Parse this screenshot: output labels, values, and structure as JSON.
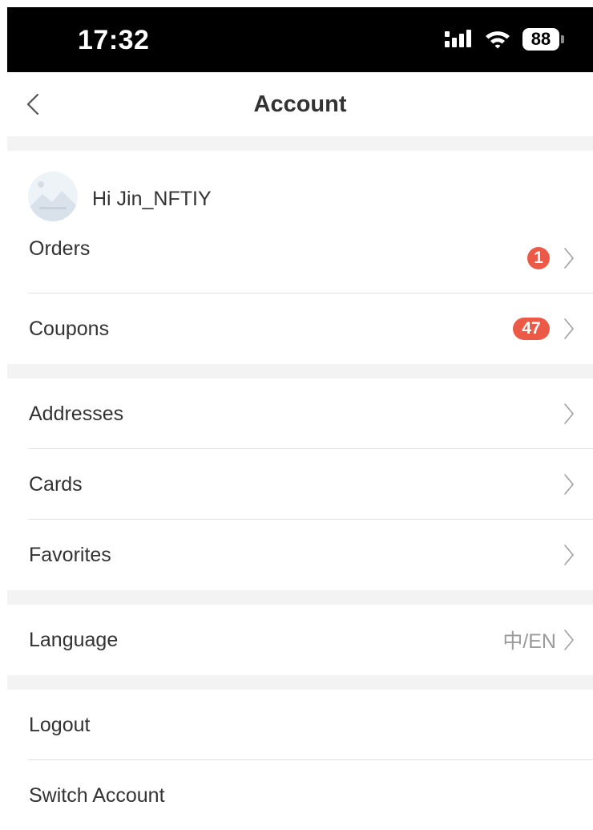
{
  "status_bar": {
    "time": "17:32",
    "battery": "88",
    "icons": [
      "signal-icon",
      "wifi-icon",
      "battery-icon"
    ]
  },
  "header": {
    "title": "Account",
    "back_icon": "chevron-left-icon"
  },
  "profile": {
    "greeting": "Hi Jin_NFTIY",
    "avatar": "avatar-image"
  },
  "sections": {
    "orders": {
      "label": "Orders",
      "badge": "1"
    },
    "coupons": {
      "label": "Coupons",
      "badge": "47"
    },
    "addresses": {
      "label": "Addresses"
    },
    "cards": {
      "label": "Cards"
    },
    "favorites": {
      "label": "Favorites"
    },
    "language": {
      "label": "Language",
      "value": "中/EN"
    },
    "logout": {
      "label": "Logout"
    },
    "switch_account": {
      "label": "Switch Account"
    }
  },
  "colors": {
    "badge": "#ec5a47",
    "divider": "#e2e2e2",
    "section_gap": "#f3f3f3",
    "status_bar": "#000000"
  }
}
